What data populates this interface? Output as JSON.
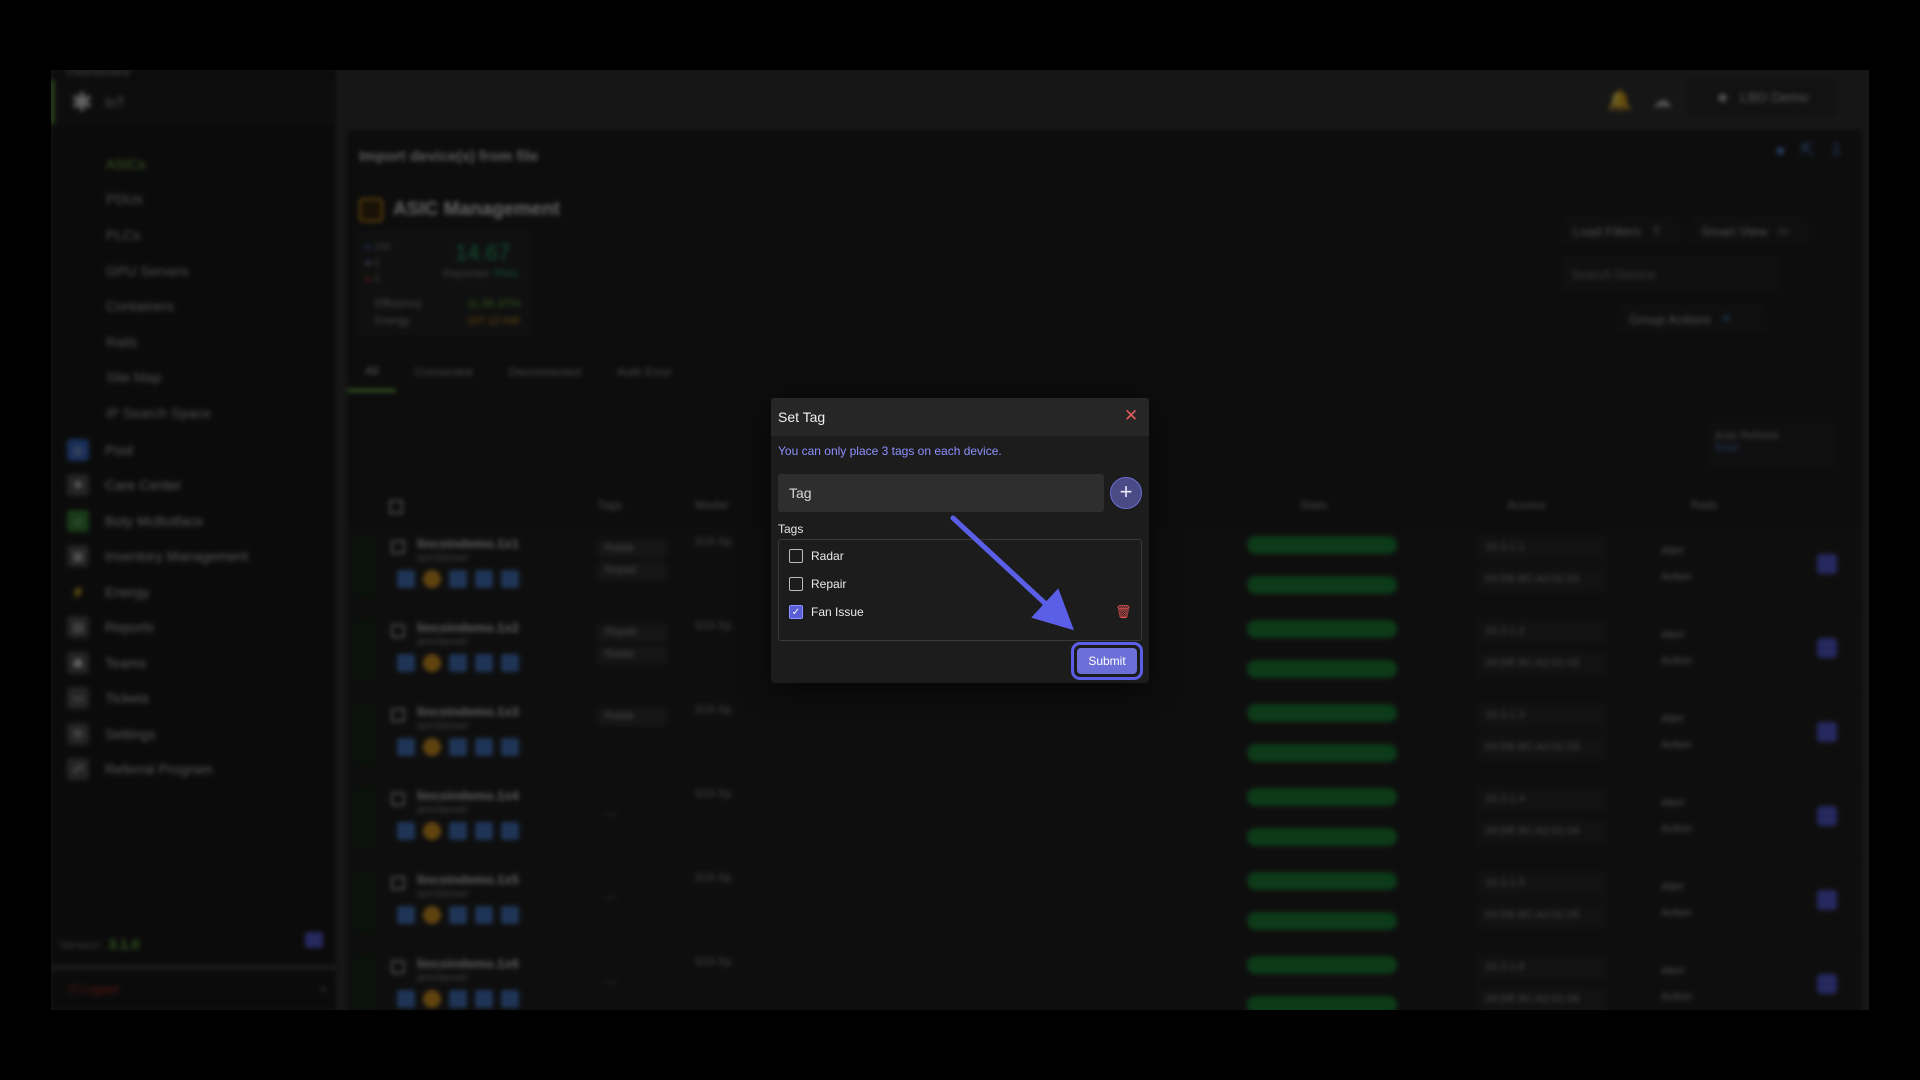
{
  "sidebar": {
    "top_item": "Dashboard",
    "iot_label": "IoT",
    "sub_items": [
      "ASICs",
      "PDUs",
      "PLCs",
      "GPU Servers",
      "Containers",
      "Rails",
      "Site Map",
      "IP Search Space"
    ],
    "main_items": [
      {
        "label": "Pool",
        "icon": "pool-icon"
      },
      {
        "label": "Care Center",
        "icon": "care-center-icon"
      },
      {
        "label": "Boty McBotface",
        "icon": "bot-icon"
      },
      {
        "label": "Inventory Management",
        "icon": "inventory-icon"
      },
      {
        "label": "Energy",
        "icon": "lightning-icon"
      },
      {
        "label": "Reports",
        "icon": "document-icon"
      },
      {
        "label": "Teams",
        "icon": "teams-icon"
      },
      {
        "label": "Tickets",
        "icon": "ticket-icon"
      },
      {
        "label": "Settings",
        "icon": "gear-icon"
      },
      {
        "label": "Referral Program",
        "icon": "referral-icon"
      }
    ],
    "version_label": "Version:",
    "version_value": "3.1.0",
    "logout": "Logout"
  },
  "header": {
    "user_label": "LBD Demo"
  },
  "page": {
    "import_title": "Import device(s) from file",
    "title": "ASIC Management",
    "summary": {
      "count_blue": "100",
      "count_purple": "0",
      "count_red": "0",
      "hashrate": "14.67",
      "reported_label": "Reported",
      "reported_unit": "PH/s",
      "efficiency_label": "Efficiency",
      "efficiency_value": "11.39 J/TH",
      "energy_label": "Energy",
      "energy_value": "167.12 kW"
    },
    "tabs": [
      "All",
      "Connected",
      "Disconnected",
      "Auth Error"
    ],
    "load_filters": "Load Filters",
    "smart_view": "Smart View",
    "search_placeholder": "Search Device",
    "group_actions": "Group Actions",
    "auto_refresh": "Auto Refresh",
    "auto_refresh_value": "5min",
    "columns": {
      "tags": "Tags",
      "model": "Model",
      "stats": "Stats",
      "access": "Access",
      "rails": "Rails"
    },
    "rows": [
      {
        "name": "lincoindemo.1x1",
        "sub": "armServer",
        "tags": [
          "Radar",
          "Repair"
        ],
        "model": "S19 Xp",
        "ip": "10.3.1.1",
        "mac": "04:DE:8C:A2:01:01"
      },
      {
        "name": "lincoindemo.1x2",
        "sub": "armServer",
        "tags": [
          "Repair",
          "Radar"
        ],
        "model": "S19 Xp",
        "ip": "10.3.1.2",
        "mac": "04:DE:8C:A2:01:02"
      },
      {
        "name": "lincoindemo.1x3",
        "sub": "armServer",
        "tags": [
          "Radar"
        ],
        "model": "S19 Xp",
        "ip": "10.3.1.3",
        "mac": "04:DE:8C:A2:01:03"
      },
      {
        "name": "lincoindemo.1x4",
        "sub": "armServer",
        "tags": [],
        "model": "S19 Xp",
        "ip": "10.3.1.4",
        "mac": "04:DE:8C:A2:01:04"
      },
      {
        "name": "lincoindemo.1x5",
        "sub": "armServer",
        "tags": [],
        "model": "S19 Xp",
        "ip": "10.3.1.5",
        "mac": "04:DE:8C:A2:01:05"
      },
      {
        "name": "lincoindemo.1x6",
        "sub": "armServer",
        "tags": [],
        "model": "S19 Xp",
        "ip": "10.3.1.6",
        "mac": "04:DE:8C:A2:01:06"
      }
    ],
    "rail_alert": "Alert",
    "rail_action": "Action"
  },
  "modal": {
    "title": "Set Tag",
    "note": "You can only place 3 tags on each device.",
    "input_placeholder": "Tag",
    "tags_label": "Tags",
    "tags": [
      {
        "label": "Radar",
        "checked": false
      },
      {
        "label": "Repair",
        "checked": false
      },
      {
        "label": "Fan Issue",
        "checked": true
      }
    ],
    "submit_label": "Submit"
  },
  "colors": {
    "accent_green": "#7bd141",
    "accent_purple": "#6c6fd8",
    "arrow": "#5b5fe8",
    "danger": "#e05555"
  }
}
